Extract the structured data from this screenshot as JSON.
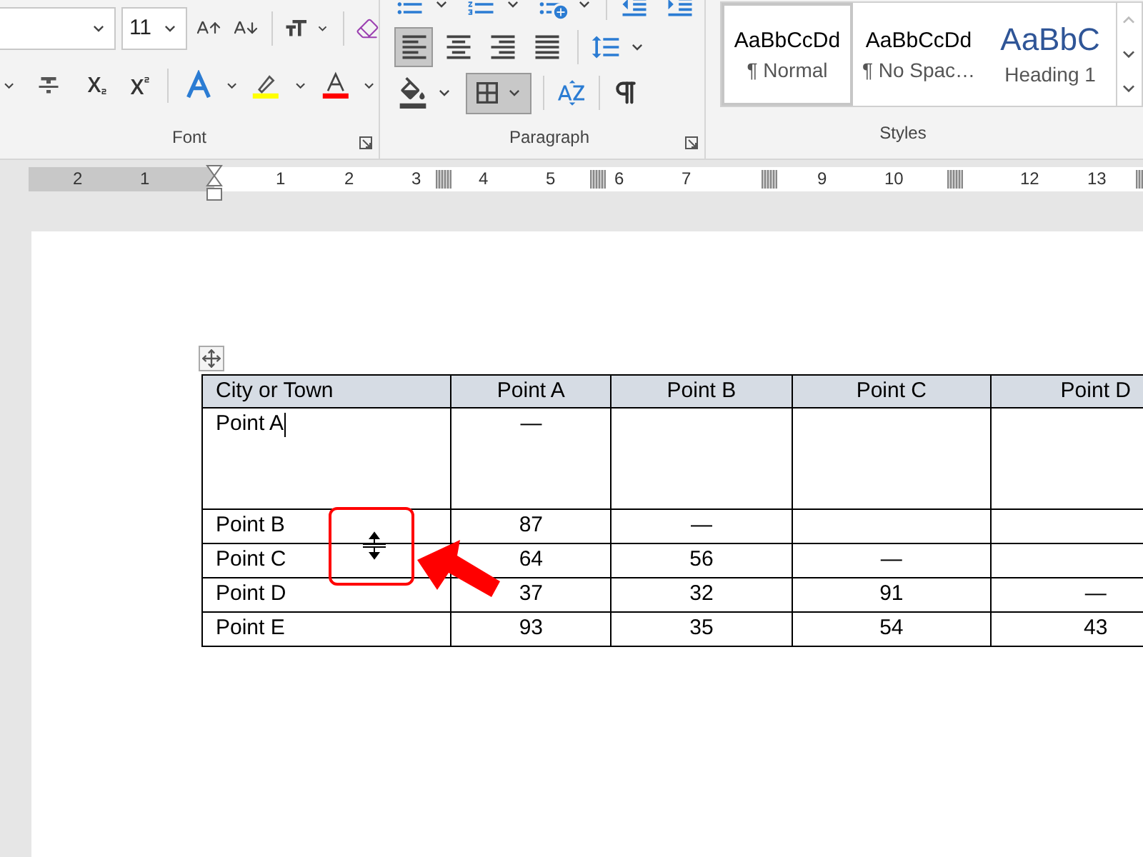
{
  "ribbon": {
    "font": {
      "label": "Font",
      "font_size": "11"
    },
    "paragraph": {
      "label": "Paragraph",
      "alignment": [
        {
          "kind": "left",
          "selected": true
        },
        {
          "kind": "center",
          "selected": false
        },
        {
          "kind": "right",
          "selected": false
        },
        {
          "kind": "justify",
          "selected": false
        }
      ],
      "borders_selected": true
    },
    "styles": {
      "label": "Styles",
      "items": [
        {
          "kind": "body",
          "preview": "AaBbCcDd",
          "name": "¶ Normal",
          "selected": true
        },
        {
          "kind": "body",
          "preview": "AaBbCcDd",
          "name": "¶ No Spac…",
          "selected": false
        },
        {
          "kind": "heading",
          "preview": "AaBbC",
          "name": "Heading 1",
          "selected": false
        }
      ]
    }
  },
  "ruler": {
    "marks": [
      {
        "kind": "number",
        "label": "2"
      },
      {
        "kind": "number",
        "label": "1"
      },
      {
        "kind": "number",
        "label": "1"
      },
      {
        "kind": "number",
        "label": "2"
      },
      {
        "kind": "number",
        "label": "3"
      },
      {
        "kind": "number",
        "label": "4"
      },
      {
        "kind": "number",
        "label": "5"
      },
      {
        "kind": "number",
        "label": "6"
      },
      {
        "kind": "number",
        "label": "7"
      },
      {
        "kind": "number",
        "label": "9"
      },
      {
        "kind": "number",
        "label": "10"
      },
      {
        "kind": "number",
        "label": "12"
      },
      {
        "kind": "number",
        "label": "13"
      }
    ]
  },
  "table": {
    "columns": [
      "City or Town",
      "Point A",
      "Point B",
      "Point C",
      "Point D"
    ],
    "rows": [
      {
        "city": "Point A",
        "values": [
          "—"
        ],
        "cursor": true
      },
      {
        "city": "Point B",
        "values": [
          "87",
          "—"
        ],
        "cursor": false
      },
      {
        "city": "Point C",
        "values": [
          "64",
          "56",
          "—"
        ],
        "cursor": false
      },
      {
        "city": "Point D",
        "values": [
          "37",
          "32",
          "91",
          "—"
        ],
        "cursor": false
      },
      {
        "city": "Point E",
        "values": [
          "93",
          "35",
          "54",
          "43"
        ],
        "cursor": false
      }
    ]
  }
}
